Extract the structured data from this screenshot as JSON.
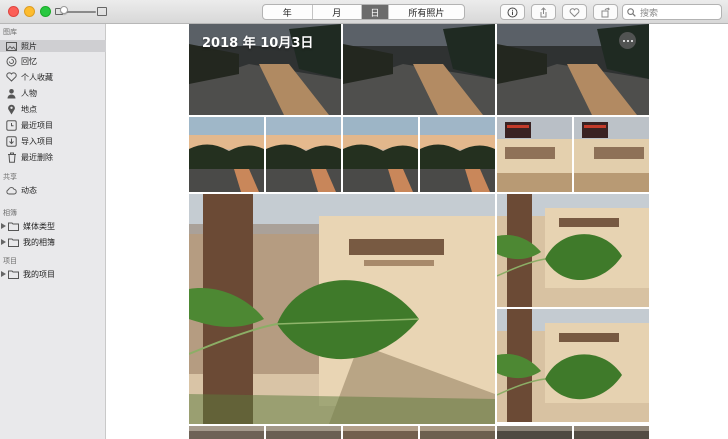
{
  "toolbar": {
    "tabs": [
      {
        "label": "年",
        "width": 50
      },
      {
        "label": "月",
        "width": 50
      },
      {
        "label": "日",
        "width": 27,
        "active": true
      },
      {
        "label": "所有照片",
        "width": 76
      }
    ],
    "search_placeholder": "搜索",
    "icons": [
      "info-icon",
      "share-icon",
      "heart-icon",
      "rotate-icon"
    ]
  },
  "sidebar": {
    "section_library": "图库",
    "library_items": [
      {
        "label": "照片",
        "icon": "photos-icon",
        "selected": true
      },
      {
        "label": "回忆",
        "icon": "memories-icon"
      },
      {
        "label": "个人收藏",
        "icon": "heart-icon"
      },
      {
        "label": "人物",
        "icon": "person-icon"
      },
      {
        "label": "地点",
        "icon": "pin-icon"
      },
      {
        "label": "最近项目",
        "icon": "clock-icon"
      },
      {
        "label": "导入项目",
        "icon": "import-icon"
      },
      {
        "label": "最近删除",
        "icon": "trash-icon"
      }
    ],
    "section_shared": "共享",
    "shared_items": [
      {
        "label": "动态",
        "icon": "cloud-icon"
      }
    ],
    "section_albums": "相簿",
    "album_items": [
      {
        "label": "媒体类型",
        "icon": "folder-icon"
      },
      {
        "label": "我的相簿",
        "icon": "folder-icon"
      }
    ],
    "section_projects": "项目",
    "project_items": [
      {
        "label": "我的项目",
        "icon": "folder-icon"
      }
    ]
  },
  "content": {
    "date_title": "2018 年 10月3日"
  }
}
